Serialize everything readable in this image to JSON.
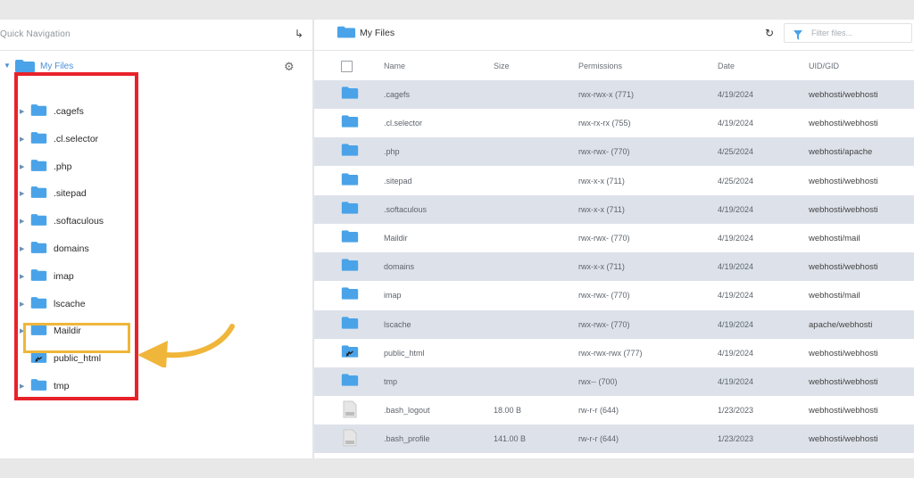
{
  "quick_nav": {
    "label": "Quick Navigation"
  },
  "tree": {
    "root_label": "My Files",
    "items": [
      {
        "label": ".cagefs",
        "kind": "folder"
      },
      {
        "label": ".cl.selector",
        "kind": "folder"
      },
      {
        "label": ".php",
        "kind": "folder"
      },
      {
        "label": ".sitepad",
        "kind": "folder"
      },
      {
        "label": ".softaculous",
        "kind": "folder"
      },
      {
        "label": "domains",
        "kind": "folder"
      },
      {
        "label": "imap",
        "kind": "folder"
      },
      {
        "label": "lscache",
        "kind": "folder"
      },
      {
        "label": "Maildir",
        "kind": "folder"
      },
      {
        "label": "public_html",
        "kind": "folder-link"
      },
      {
        "label": "tmp",
        "kind": "folder"
      }
    ]
  },
  "file_panel": {
    "title": "My Files",
    "filter_placeholder": "Filter files...",
    "columns": {
      "name": "Name",
      "size": "Size",
      "permissions": "Permissions",
      "date": "Date",
      "uid": "UID/GID"
    },
    "rows": [
      {
        "name": ".cagefs",
        "size": "",
        "permissions": "rwx-rwx-x (771)",
        "date": "4/19/2024",
        "uid": "webhosti/webhosti",
        "type": "folder"
      },
      {
        "name": ".cl.selector",
        "size": "",
        "permissions": "rwx-rx-rx (755)",
        "date": "4/19/2024",
        "uid": "webhosti/webhosti",
        "type": "folder"
      },
      {
        "name": ".php",
        "size": "",
        "permissions": "rwx-rwx- (770)",
        "date": "4/25/2024",
        "uid": "webhosti/apache",
        "type": "folder"
      },
      {
        "name": ".sitepad",
        "size": "",
        "permissions": "rwx-x-x (711)",
        "date": "4/25/2024",
        "uid": "webhosti/webhosti",
        "type": "folder"
      },
      {
        "name": ".softaculous",
        "size": "",
        "permissions": "rwx-x-x (711)",
        "date": "4/19/2024",
        "uid": "webhosti/webhosti",
        "type": "folder"
      },
      {
        "name": "Maildir",
        "size": "",
        "permissions": "rwx-rwx- (770)",
        "date": "4/19/2024",
        "uid": "webhosti/mail",
        "type": "folder"
      },
      {
        "name": "domains",
        "size": "",
        "permissions": "rwx-x-x (711)",
        "date": "4/19/2024",
        "uid": "webhosti/webhosti",
        "type": "folder"
      },
      {
        "name": "imap",
        "size": "",
        "permissions": "rwx-rwx- (770)",
        "date": "4/19/2024",
        "uid": "webhosti/mail",
        "type": "folder"
      },
      {
        "name": "lscache",
        "size": "",
        "permissions": "rwx-rwx- (770)",
        "date": "4/19/2024",
        "uid": "apache/webhosti",
        "type": "folder"
      },
      {
        "name": "public_html",
        "size": "",
        "permissions": "rwx-rwx-rwx (777)",
        "date": "4/19/2024",
        "uid": "webhosti/webhosti",
        "type": "folder-link"
      },
      {
        "name": "tmp",
        "size": "",
        "permissions": "rwx-- (700)",
        "date": "4/19/2024",
        "uid": "webhosti/webhosti",
        "type": "folder"
      },
      {
        "name": ".bash_logout",
        "size": "18.00 B",
        "permissions": "rw-r-r (644)",
        "date": "1/23/2023",
        "uid": "webhosti/webhosti",
        "type": "file"
      },
      {
        "name": ".bash_profile",
        "size": "141.00 B",
        "permissions": "rw-r-r (644)",
        "date": "1/23/2023",
        "uid": "webhosti/webhosti",
        "type": "file"
      }
    ]
  },
  "icons": {
    "folder_color": "#4aa3e8",
    "enter": "return-arrow-icon",
    "gear": "gear-icon",
    "refresh": "refresh-icon",
    "filter": "funnel-icon"
  },
  "annotations": {
    "tree_box_color": "#e8222a",
    "highlight_color": "#f0b63a"
  }
}
